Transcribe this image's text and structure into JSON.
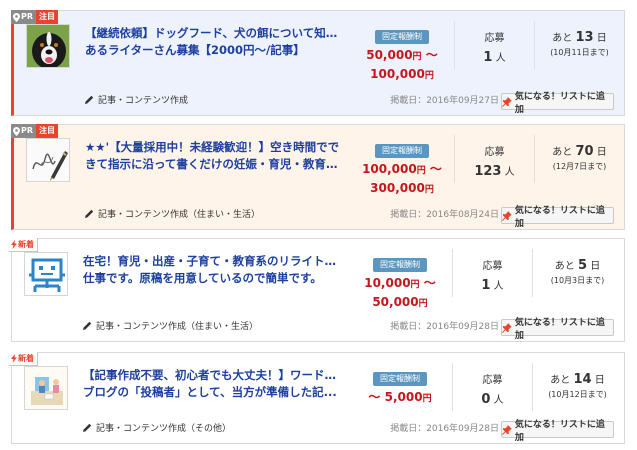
{
  "listings": [
    {
      "badge": {
        "pr": "PR",
        "label": "注目"
      },
      "title_lines": [
        "【継続依頼】ドッグフード、犬の餌について知識の",
        "あるライターさん募集【2000円〜/記事】"
      ],
      "category": "記事・コンテンツ作成",
      "pay_type": "固定報酬制",
      "pay_min": "50,000",
      "pay_max": "100,000",
      "yen": "円",
      "tilde": "〜",
      "apply_label": "応募",
      "apply_count": "1",
      "apply_unit": "人",
      "deadline_prefix": "あと",
      "deadline_days": "13",
      "deadline_unit": "日",
      "deadline_date": "(10月11日まで)",
      "posted": "掲載日：2016年09月27日",
      "add_button": "気になる！リストに追加"
    },
    {
      "badge": {
        "pr": "PR",
        "label": "注目"
      },
      "title_lines": [
        "★★'【大量採用中！未経験歓迎！】空き時間でで",
        "きて指示に沿って書くだけの妊娠・育児・教育に..."
      ],
      "category": "記事・コンテンツ作成（住まい・生活）",
      "pay_type": "固定報酬制",
      "pay_min": "100,000",
      "pay_max": "300,000",
      "yen": "円",
      "tilde": "〜",
      "apply_label": "応募",
      "apply_count": "123",
      "apply_unit": "人",
      "deadline_prefix": "あと",
      "deadline_days": "70",
      "deadline_unit": "日",
      "deadline_date": "(12月7日まで)",
      "posted": "掲載日：2016年08月24日",
      "add_button": "気になる！リストに追加"
    },
    {
      "badge": {
        "label": "新着"
      },
      "title_lines": [
        "在宅！育児・出産・子育て・教育系のリライトのお",
        "仕事です。原稿を用意しているので簡単です。"
      ],
      "category": "記事・コンテンツ作成（住まい・生活）",
      "pay_type": "固定報酬制",
      "pay_min": "10,000",
      "pay_max": "50,000",
      "yen": "円",
      "tilde": "〜",
      "apply_label": "応募",
      "apply_count": "1",
      "apply_unit": "人",
      "deadline_prefix": "あと",
      "deadline_days": "5",
      "deadline_unit": "日",
      "deadline_date": "(10月3日まで)",
      "posted": "掲載日：2016年09月28日",
      "add_button": "気になる！リストに追加"
    },
    {
      "badge": {
        "label": "新着"
      },
      "title_lines": [
        "【記事作成不要、初心者でも大丈夫！】ワードプレス",
        "ブログの「投稿者」として、当方が準備した記..."
      ],
      "category": "記事・コンテンツ作成（その他）",
      "pay_type": "固定報酬制",
      "pay_max": "5,000",
      "yen": "円",
      "tilde": "〜",
      "apply_label": "応募",
      "apply_count": "0",
      "apply_unit": "人",
      "deadline_prefix": "あと",
      "deadline_days": "14",
      "deadline_unit": "日",
      "deadline_date": "(10月12日まで)",
      "posted": "掲載日：2016年09月28日",
      "add_button": "気になる！リストに追加"
    }
  ],
  "icons": {
    "pin": "map-pin-icon",
    "bolt": "lightning-icon",
    "pencil": "pencil-icon",
    "pushpin": "pushpin-icon"
  },
  "colors": {
    "accent_red": "#e9432b",
    "title_blue": "#1d3fa0",
    "price_red": "#c4161c",
    "tag_blue": "#5a96c0",
    "card_blue": "#eef2fd",
    "card_peach": "#fef4ea"
  }
}
